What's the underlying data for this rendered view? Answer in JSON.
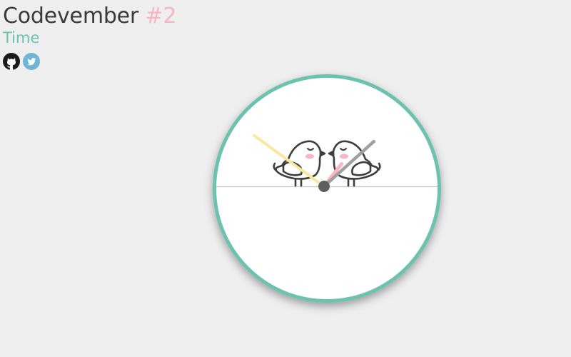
{
  "header": {
    "title": "Codevember",
    "number": "#2",
    "subtitle": "Time"
  },
  "social": [
    {
      "name": "github-icon"
    },
    {
      "name": "twitter-icon"
    }
  ],
  "colors": {
    "background": "#eeefee",
    "clock_rim": "#6cc3ad",
    "clock_face": "#ffffff",
    "hour_hand": "#f6b6c4",
    "minute_hand": "#a0a0a0",
    "second_hand": "#fbe6a0",
    "center_pin": "#5e5e5e",
    "title_accent": "#f6b6c4",
    "subtitle": "#6cc3ad"
  },
  "clock": {
    "hour_hand_deg": 38,
    "minute_hand_deg": 48,
    "second_hand_deg": -54,
    "illustration": "two-lovebirds-on-wire"
  }
}
